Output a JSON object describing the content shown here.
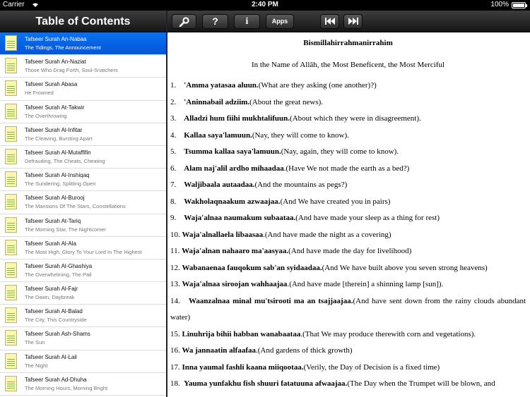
{
  "status": {
    "carrier": "Carrier",
    "time": "2:40 PM",
    "battery": "100%"
  },
  "left": {
    "title": "Table of Contents",
    "items": [
      {
        "title": "Tafseer Surah An-Nabaa",
        "subtitle": "The Tidings, The Announcement"
      },
      {
        "title": "Tafseer Surah An-Naziat",
        "subtitle": "Those Who Drag Forth, Soul-Snatchers"
      },
      {
        "title": "Tafseer Surah Abasa",
        "subtitle": "He Frowned"
      },
      {
        "title": "Tafseer Surah At-Takwir",
        "subtitle": "The Overthrowing"
      },
      {
        "title": "Tafseer Surah Al-Infitar",
        "subtitle": "The Cleaving, Bursting Apart"
      },
      {
        "title": "Tafseer Surah Al-Mutaffifin",
        "subtitle": "Defrauding, The Cheats, Cheating"
      },
      {
        "title": "Tafseer Surah Al-Inshiqaq",
        "subtitle": "The Sundering, Splitting Open"
      },
      {
        "title": "Tafseer Surah Al-Burooj",
        "subtitle": "The Mansions Of The Stars, Constellations"
      },
      {
        "title": "Tafseer Surah At-Tariq",
        "subtitle": "The Morning Star, The Nightcomer"
      },
      {
        "title": "Tafseer Surah Al-Ala",
        "subtitle": "The Most High, Glory To Your Lord In The Highest"
      },
      {
        "title": "Tafseer Surah Al-Ghashiya",
        "subtitle": "The Overwhelming, The Pall"
      },
      {
        "title": "Tafseer Surah Al-Fajr",
        "subtitle": "The Dawn, Daybreak"
      },
      {
        "title": "Tafseer Surah Al-Balad",
        "subtitle": "The City, This Countryside"
      },
      {
        "title": "Tafseer Surah Ash-Shams",
        "subtitle": "The Sun"
      },
      {
        "title": "Tafseer Surah Al-Lail",
        "subtitle": "The Night"
      },
      {
        "title": "Tafseer Surah Ad-Dhuha",
        "subtitle": "The Morning Hours, Morning Bright"
      }
    ]
  },
  "toolbar": {
    "help_label": "?",
    "info_label": "i",
    "apps_label": "Apps"
  },
  "content": {
    "bismillah": "Bismillahirrahmanirrahim",
    "intro": "In the Name of Allâh, the Most Beneficent, the Most Merciful",
    "verses": [
      {
        "num": "1.",
        "arabic": "'Amma yatasaa aluun.",
        "english": "(What are they asking (one another)?)"
      },
      {
        "num": "2.",
        "arabic": "'Aninnabail adziim.",
        "english": "(About the great news)."
      },
      {
        "num": "3.",
        "arabic": "Alladzi hum fiihi mukhtalifuun.",
        "english": "(About which they were in disagreement)."
      },
      {
        "num": "4.",
        "arabic": "Kallaa saya'lamuun.",
        "english": "(Nay, they will come to know)."
      },
      {
        "num": "5.",
        "arabic": "Tsumma kallaa saya'lamuun.",
        "english": "(Nay, again, they will come to know)."
      },
      {
        "num": "6.",
        "arabic": "Alam naj'alil ardho mihaadaa",
        "english": ".(Have We not made the earth as a bed?)"
      },
      {
        "num": "7.",
        "arabic": "Waljibaala autaadaa.",
        "english": "(And the mountains as pegs?)"
      },
      {
        "num": "8.",
        "arabic": "Wakholaqnaakum azwaajaa.",
        "english": "(And We have created you in pairs)"
      },
      {
        "num": "9.",
        "arabic": "Waja'alnaa naumakum subaataa.",
        "english": "(And have made your sleep as a thing for rest)"
      },
      {
        "num": "10.",
        "arabic": "Waja'alnallaela libaasaa",
        "english": ".(And have made the night as a covering)"
      },
      {
        "num": "11.",
        "arabic": "Waja'alnan nahaaro ma'aasyaa.",
        "english": "(And have made the day for livelihood)"
      },
      {
        "num": "12.",
        "arabic": "Wabanaenaa fauqokum sab'an syidaadaa.",
        "english": "(And We have built above you seven strong heavens)"
      },
      {
        "num": "13.",
        "arabic": "Waja'alnaa siroojan wahhaajaa",
        "english": ".(And have made [therein] a shinning lamp [sun])."
      },
      {
        "num": "14.",
        "arabic": "Waanzalnaa minal mu'tsirooti ma an tsajjaajaa.",
        "english": "(And have sent down from the rainy clouds abundant water)"
      },
      {
        "num": "15.",
        "arabic": "Linuhrija bihii habban wanabaataa",
        "english": ".(That We may produce therewith corn and vegetations)."
      },
      {
        "num": "16.",
        "arabic": "Wa jannaatin alfaafaa",
        "english": ".(And gardens of thick growth)"
      },
      {
        "num": "17.",
        "arabic": "Inna yaumal fashli kaana miiqootaa.",
        "english": "(Verily, the Day of Decision is a fixed time)"
      },
      {
        "num": "18.",
        "arabic": "Yauma yunfakhu fish shuuri fatatuuna afwaajaa.",
        "english": "(The Day when the Trumpet will be blown, and"
      }
    ]
  }
}
